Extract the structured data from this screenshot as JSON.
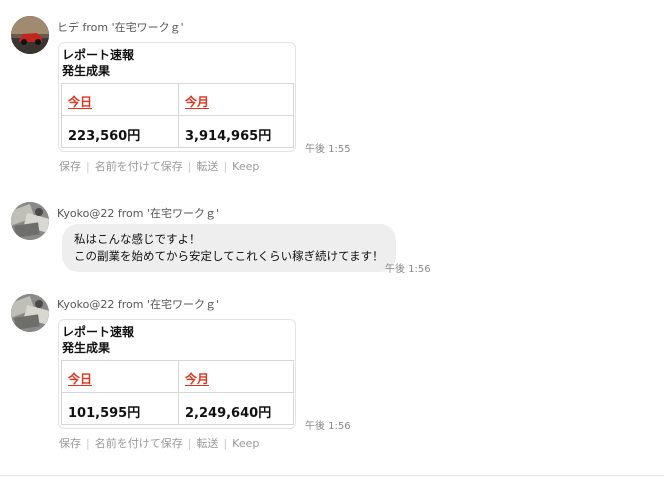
{
  "messages": [
    {
      "sender": "ヒデ from '在宅ワークｇ'",
      "card": {
        "title": "レポート速報",
        "subtitle": "発生成果",
        "today_label": "今日",
        "month_label": "今月",
        "today_value": "223,560円",
        "month_value": "3,914,965円"
      },
      "time": "午後 1:55",
      "actions": [
        "保存",
        "名前を付けて保存",
        "転送",
        "Keep"
      ]
    },
    {
      "sender": "Kyoko@22 from '在宅ワークｇ'",
      "text_lines": [
        "私はこんな感じですよ！",
        "この副業を始めてから安定してこれくらい稼ぎ続けてます！"
      ],
      "time": "午後 1:56"
    },
    {
      "sender": "Kyoko@22 from '在宅ワークｇ'",
      "card": {
        "title": "レポート速報",
        "subtitle": "発生成果",
        "today_label": "今日",
        "month_label": "今月",
        "today_value": "101,595円",
        "month_value": "2,249,640円"
      },
      "time": "午後 1:56",
      "actions": [
        "保存",
        "名前を付けて保存",
        "転送",
        "Keep"
      ]
    }
  ],
  "colors": {
    "accent_red": "#e0331c",
    "bubble_bg": "#eeeeee"
  },
  "icons": {
    "avatar_1": "car-photo-avatar",
    "avatar_2": "money-photo-avatar"
  }
}
